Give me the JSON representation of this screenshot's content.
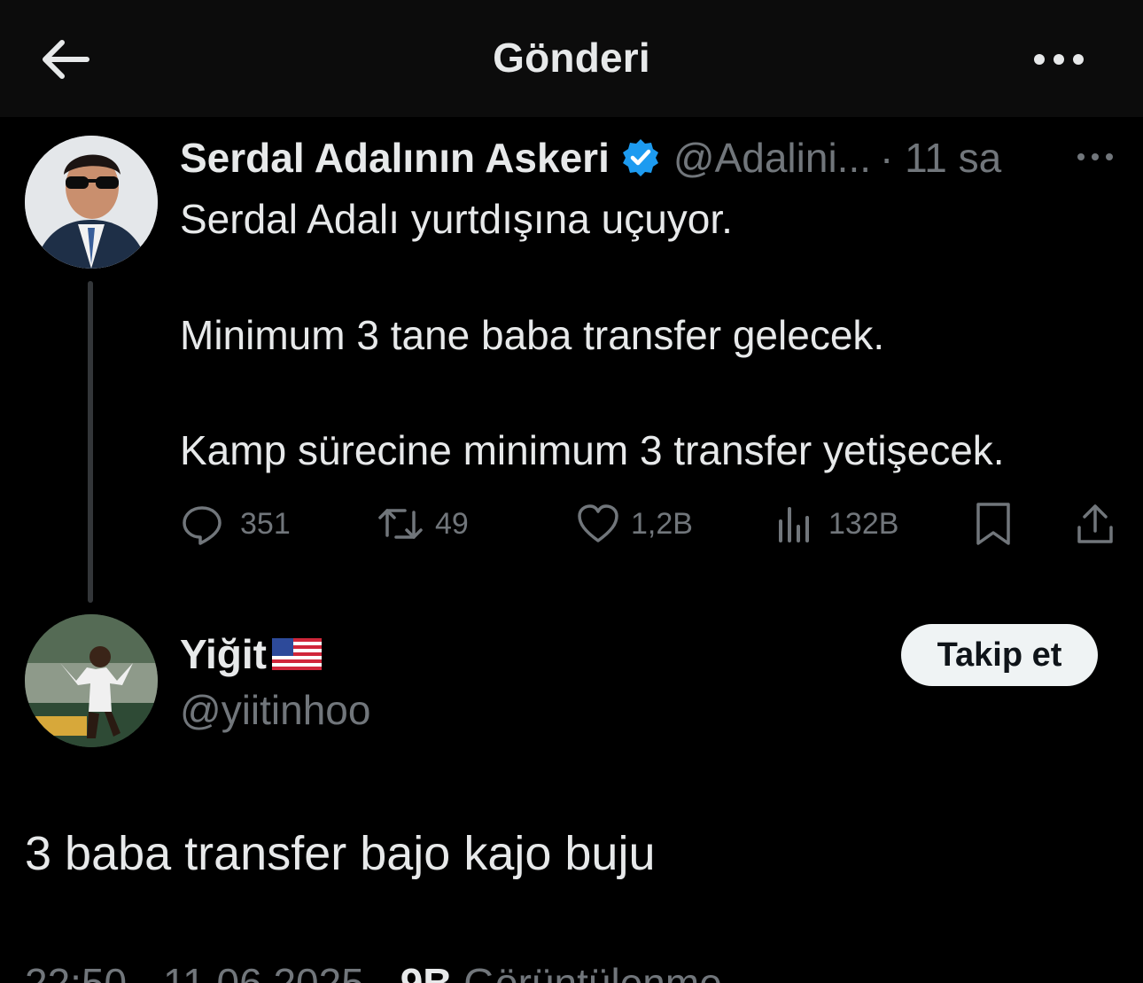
{
  "header": {
    "title": "Gönderi",
    "back_icon": "arrow-left-icon",
    "more_icon": "more-horizontal-icon"
  },
  "parent_tweet": {
    "display_name": "Serdal Adalının Askeri",
    "verified_icon": "verified-badge-icon",
    "handle": "@Adalini...",
    "time": "· 11 sa",
    "lines": [
      "Serdal Adalı yurtdışına uçuyor.",
      "Minimum 3 tane baba transfer gelecek.",
      "Kamp sürecine minimum 3 transfer yetişecek."
    ],
    "actions": {
      "replies": "351",
      "retweets": "49",
      "likes": "1,2B",
      "views": "132B"
    }
  },
  "main_tweet": {
    "display_name": "Yiğit",
    "flag": "🇺🇸",
    "handle": "@yiitinhoo",
    "follow_label": "Takip et",
    "text": "3 baba transfer bajo kajo buju",
    "meta": {
      "time": "22:50 · 11.06.2025 ·",
      "views_count": "9B",
      "views_label": "Görüntülenme"
    }
  },
  "colors": {
    "background": "#000000",
    "text": "#e7e9ea",
    "muted": "#71767b",
    "verified": "#1d9bf0",
    "follow_bg": "#eff3f4"
  }
}
